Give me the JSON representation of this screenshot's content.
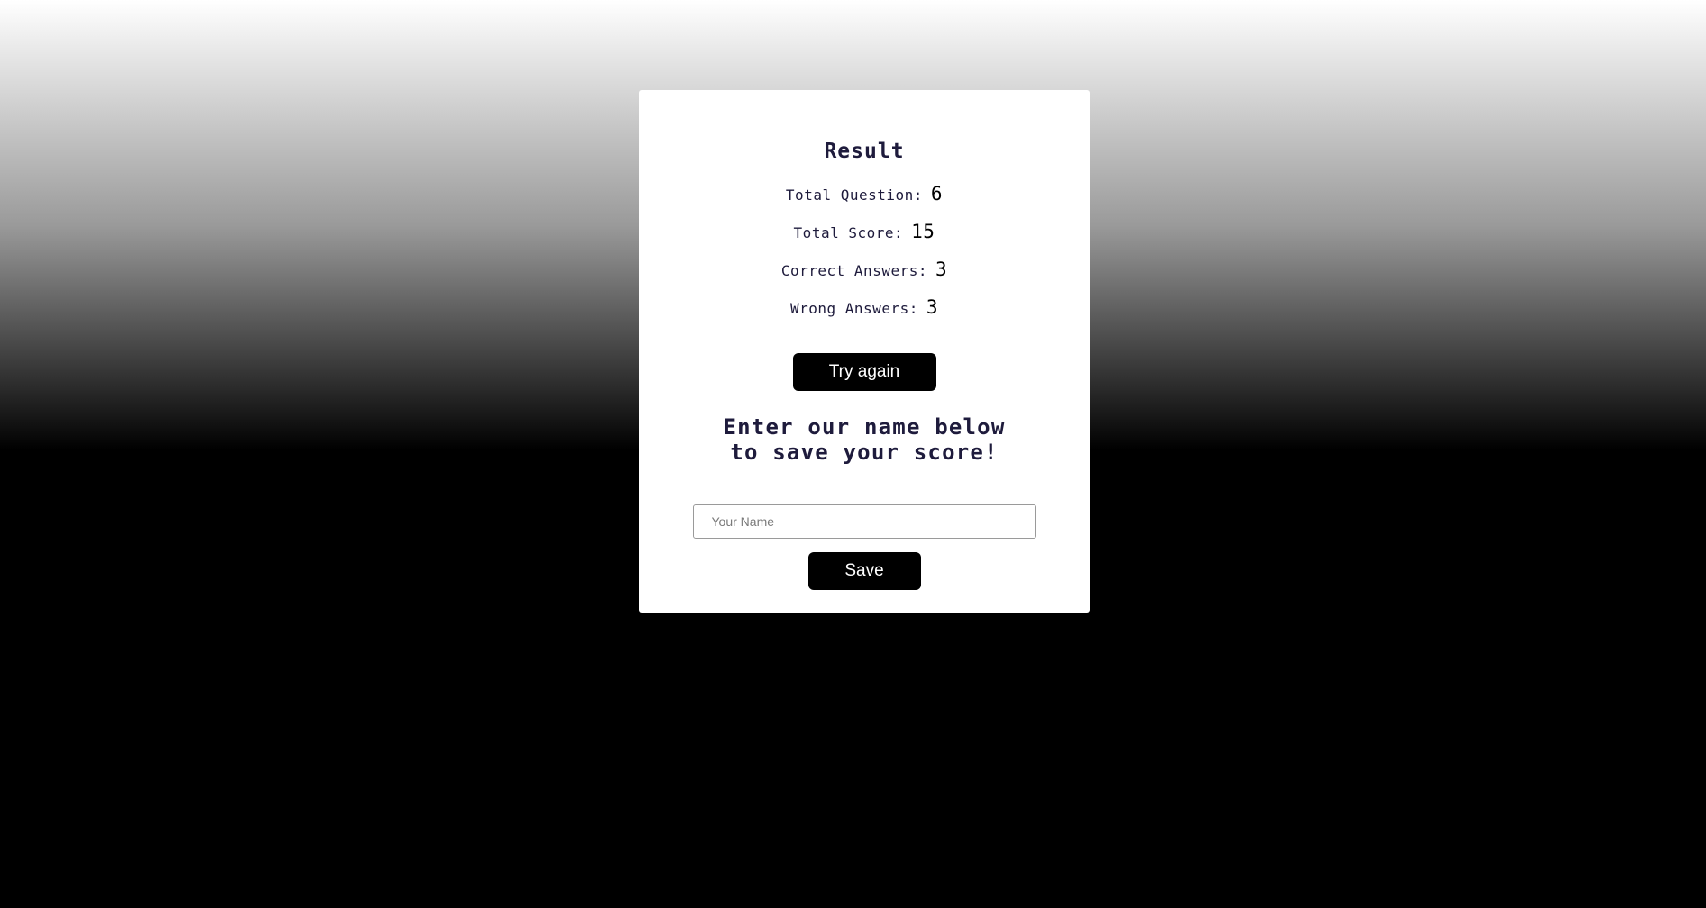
{
  "result": {
    "title": "Result",
    "stats": [
      {
        "label": "Total Question:",
        "value": "6"
      },
      {
        "label": "Total Score:",
        "value": "15"
      },
      {
        "label": "Correct Answers:",
        "value": "3"
      },
      {
        "label": "Wrong Answers:",
        "value": "3"
      }
    ],
    "try_again_label": "Try again"
  },
  "save": {
    "heading_line1": "Enter our name below",
    "heading_line2": "to save your score!",
    "name_placeholder": "Your Name",
    "name_value": "",
    "button_label": "Save"
  },
  "colors": {
    "heading_text": "#1e1b3c",
    "button_bg": "#000000",
    "button_text": "#ffffff",
    "card_bg": "#ffffff"
  }
}
